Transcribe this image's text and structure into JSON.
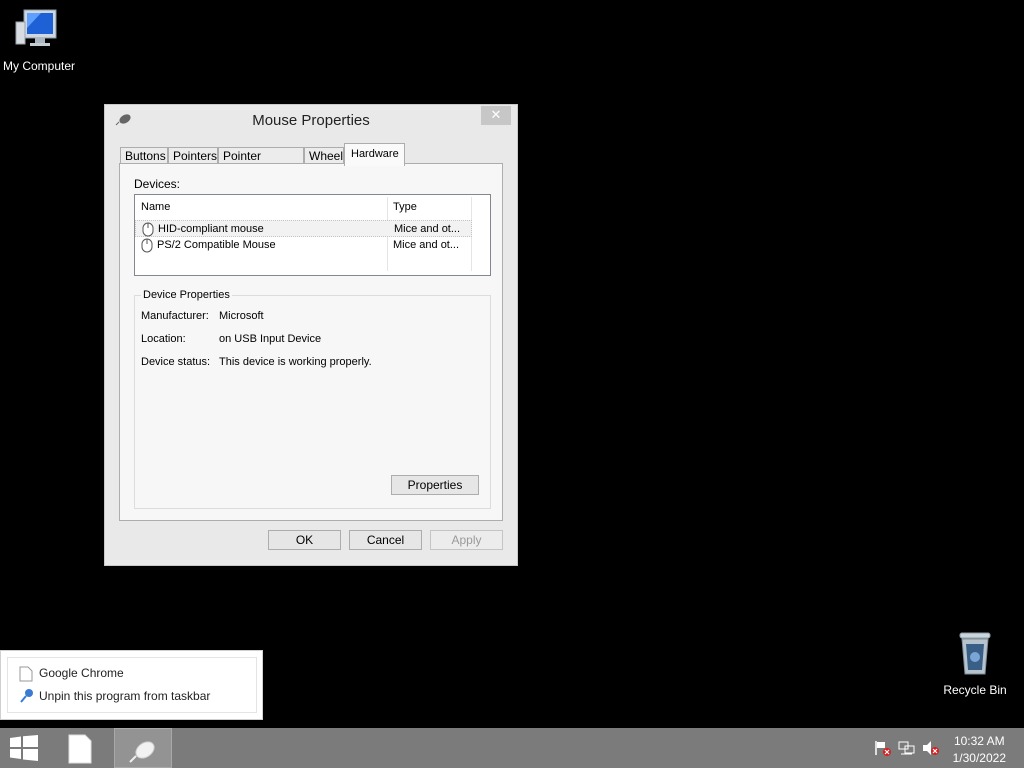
{
  "desktop": {
    "my_computer_label": "My Computer",
    "recycle_bin_label": "Recycle Bin"
  },
  "dialog": {
    "title": "Mouse Properties",
    "close_label": "✕",
    "tabs": [
      "Buttons",
      "Pointers",
      "Pointer Options",
      "Wheel",
      "Hardware"
    ],
    "active_tab": "Hardware",
    "devices_label": "Devices:",
    "columns": [
      "Name",
      "Type"
    ],
    "devices": [
      {
        "name": "HID-compliant mouse",
        "type": "Mice and ot..."
      },
      {
        "name": "PS/2 Compatible Mouse",
        "type": "Mice and ot..."
      }
    ],
    "device_properties": {
      "title": "Device Properties",
      "manufacturer_label": "Manufacturer:",
      "manufacturer": "Microsoft",
      "location_label": "Location:",
      "location": "on USB Input Device",
      "status_label": "Device status:",
      "status": "This device is working properly.",
      "properties_button": "Properties"
    },
    "buttons": {
      "ok": "OK",
      "cancel": "Cancel",
      "apply": "Apply"
    }
  },
  "jumplist": {
    "items": [
      "Google Chrome",
      "Unpin this program from taskbar"
    ]
  },
  "taskbar": {
    "time": "10:32 AM",
    "date": "1/30/2022"
  },
  "colors": {
    "desktop": "#000000",
    "taskbar": "#7b7b7b",
    "dialog_bg": "#e9e9e9"
  }
}
